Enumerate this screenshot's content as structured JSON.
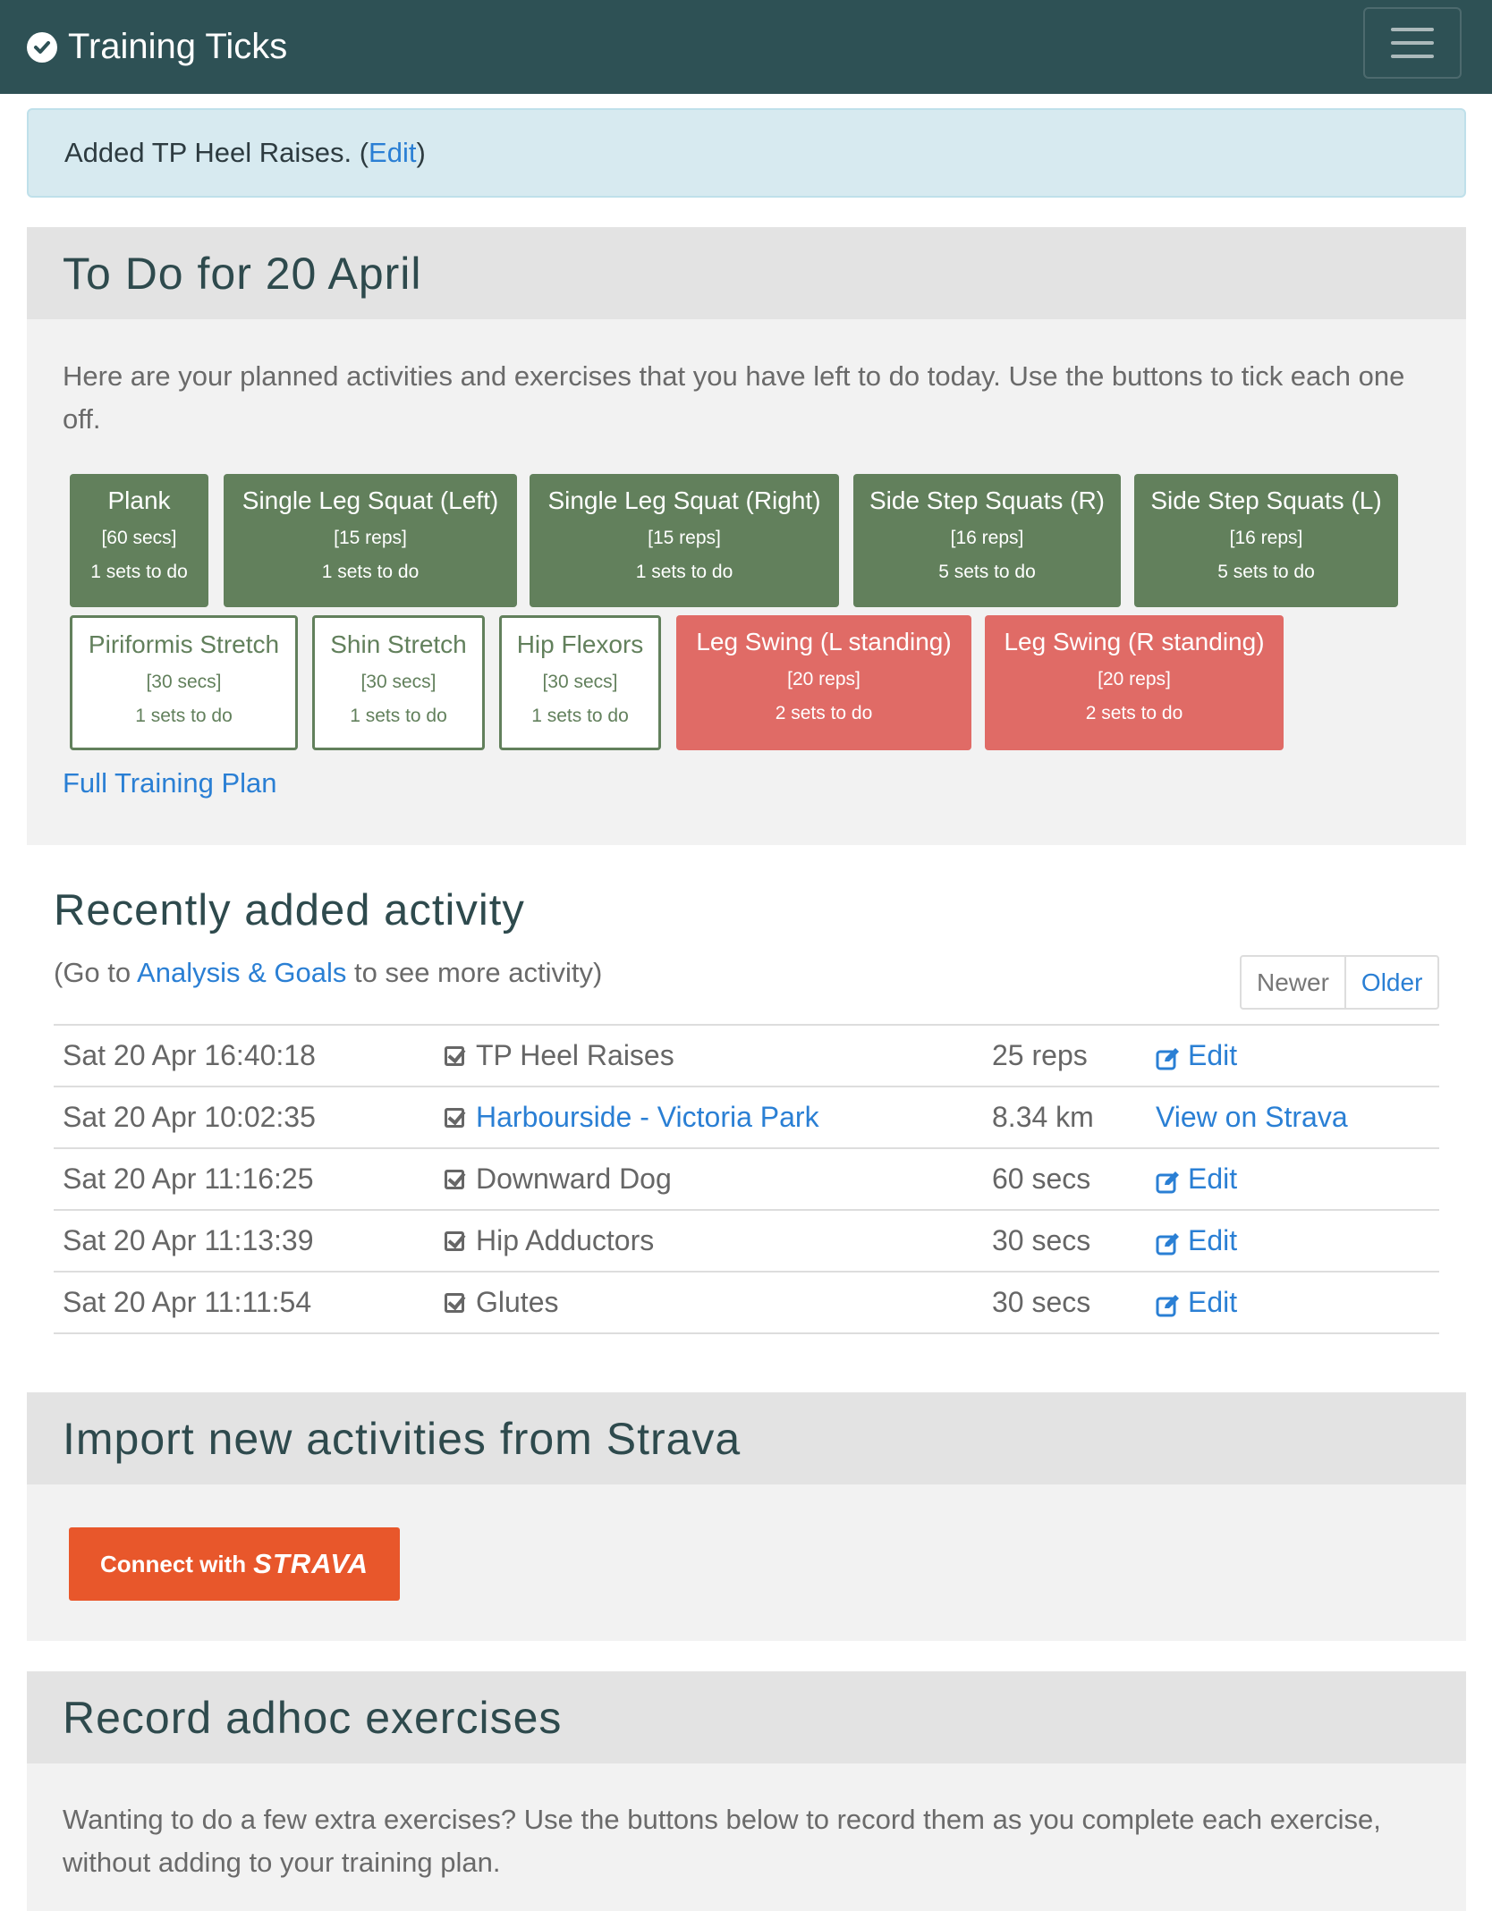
{
  "navbar": {
    "brand": "Training Ticks",
    "brand_icon": "check-circle-icon",
    "menu_icon": "hamburger-icon",
    "color": "#2e5155"
  },
  "alert": {
    "prefix": "Added TP Heel Raises. (",
    "link": "Edit",
    "suffix": ")"
  },
  "todo": {
    "title": "To Do for 20 April",
    "description": "Here are your planned activities and exercises that you have left to do today. Use the buttons to tick each one off.",
    "items": [
      {
        "name": "Plank",
        "detail": "[60 secs]",
        "sets": "1 sets to do",
        "style": "solid-green"
      },
      {
        "name": "Single Leg Squat (Left)",
        "detail": "[15 reps]",
        "sets": "1 sets to do",
        "style": "solid-green"
      },
      {
        "name": "Single Leg Squat (Right)",
        "detail": "[15 reps]",
        "sets": "1 sets to do",
        "style": "solid-green"
      },
      {
        "name": "Side Step Squats (R)",
        "detail": "[16 reps]",
        "sets": "5 sets to do",
        "style": "solid-green"
      },
      {
        "name": "Side Step Squats (L)",
        "detail": "[16 reps]",
        "sets": "5 sets to do",
        "style": "solid-green"
      },
      {
        "name": "Piriformis Stretch",
        "detail": "[30 secs]",
        "sets": "1 sets to do",
        "style": "outline-green"
      },
      {
        "name": "Shin Stretch",
        "detail": "[30 secs]",
        "sets": "1 sets to do",
        "style": "outline-green"
      },
      {
        "name": "Hip Flexors",
        "detail": "[30 secs]",
        "sets": "1 sets to do",
        "style": "outline-green"
      },
      {
        "name": "Leg Swing (L standing)",
        "detail": "[20 reps]",
        "sets": "2 sets to do",
        "style": "solid-red"
      },
      {
        "name": "Leg Swing (R standing)",
        "detail": "[20 reps]",
        "sets": "2 sets to do",
        "style": "solid-red"
      }
    ],
    "full_plan_link": "Full Training Plan"
  },
  "recent": {
    "title": "Recently added activity",
    "sub_prefix": "(Go to ",
    "sub_link": "Analysis & Goals",
    "sub_suffix": " to see more activity)",
    "pager": {
      "newer": "Newer",
      "older": "Older"
    },
    "rows": [
      {
        "date": "Sat 20 Apr 16:40:18",
        "name": "TP Heel Raises",
        "amount": "25 reps",
        "action": "Edit",
        "name_is_link": false
      },
      {
        "date": "Sat 20 Apr 10:02:35",
        "name": "Harbourside - Victoria Park",
        "amount": "8.34 km",
        "action": "View on Strava",
        "name_is_link": true
      },
      {
        "date": "Sat 20 Apr 11:16:25",
        "name": "Downward Dog",
        "amount": "60 secs",
        "action": "Edit",
        "name_is_link": false
      },
      {
        "date": "Sat 20 Apr 11:13:39",
        "name": "Hip Adductors",
        "amount": "30 secs",
        "action": "Edit",
        "name_is_link": false
      },
      {
        "date": "Sat 20 Apr 11:11:54",
        "name": "Glutes",
        "amount": "30 secs",
        "action": "Edit",
        "name_is_link": false
      }
    ]
  },
  "strava": {
    "title": "Import new activities from Strava",
    "button_prefix": "Connect with",
    "button_brand": "STRAVA",
    "color": "#e8572b"
  },
  "adhoc": {
    "title": "Record adhoc exercises",
    "description": "Wanting to do a few extra exercises? Use the buttons below to record them as you complete each exercise, without adding to your training plan."
  }
}
